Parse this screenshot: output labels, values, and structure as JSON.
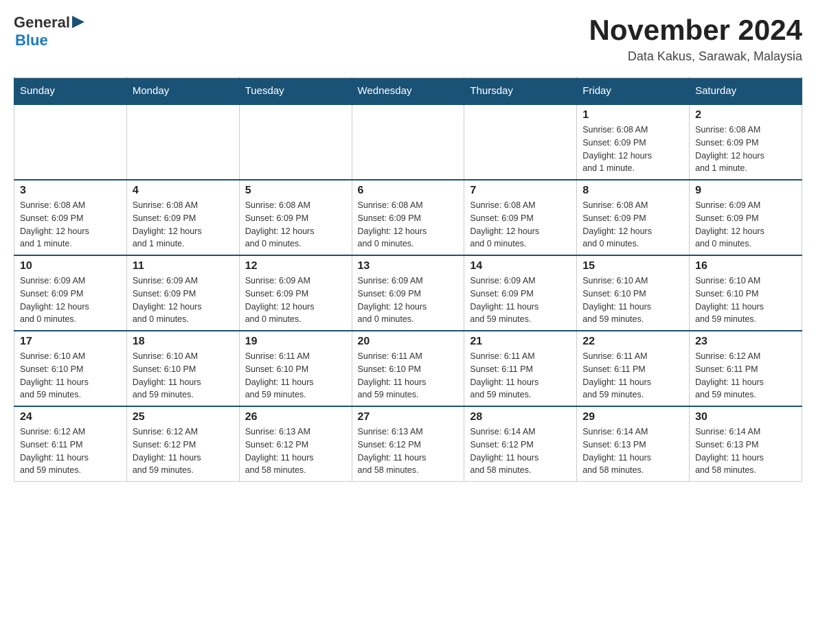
{
  "header": {
    "logo_text_general": "General",
    "logo_text_blue": "Blue",
    "month_title": "November 2024",
    "location": "Data Kakus, Sarawak, Malaysia"
  },
  "weekdays": [
    "Sunday",
    "Monday",
    "Tuesday",
    "Wednesday",
    "Thursday",
    "Friday",
    "Saturday"
  ],
  "weeks": [
    [
      {
        "day": "",
        "info": ""
      },
      {
        "day": "",
        "info": ""
      },
      {
        "day": "",
        "info": ""
      },
      {
        "day": "",
        "info": ""
      },
      {
        "day": "",
        "info": ""
      },
      {
        "day": "1",
        "info": "Sunrise: 6:08 AM\nSunset: 6:09 PM\nDaylight: 12 hours\nand 1 minute."
      },
      {
        "day": "2",
        "info": "Sunrise: 6:08 AM\nSunset: 6:09 PM\nDaylight: 12 hours\nand 1 minute."
      }
    ],
    [
      {
        "day": "3",
        "info": "Sunrise: 6:08 AM\nSunset: 6:09 PM\nDaylight: 12 hours\nand 1 minute."
      },
      {
        "day": "4",
        "info": "Sunrise: 6:08 AM\nSunset: 6:09 PM\nDaylight: 12 hours\nand 1 minute."
      },
      {
        "day": "5",
        "info": "Sunrise: 6:08 AM\nSunset: 6:09 PM\nDaylight: 12 hours\nand 0 minutes."
      },
      {
        "day": "6",
        "info": "Sunrise: 6:08 AM\nSunset: 6:09 PM\nDaylight: 12 hours\nand 0 minutes."
      },
      {
        "day": "7",
        "info": "Sunrise: 6:08 AM\nSunset: 6:09 PM\nDaylight: 12 hours\nand 0 minutes."
      },
      {
        "day": "8",
        "info": "Sunrise: 6:08 AM\nSunset: 6:09 PM\nDaylight: 12 hours\nand 0 minutes."
      },
      {
        "day": "9",
        "info": "Sunrise: 6:09 AM\nSunset: 6:09 PM\nDaylight: 12 hours\nand 0 minutes."
      }
    ],
    [
      {
        "day": "10",
        "info": "Sunrise: 6:09 AM\nSunset: 6:09 PM\nDaylight: 12 hours\nand 0 minutes."
      },
      {
        "day": "11",
        "info": "Sunrise: 6:09 AM\nSunset: 6:09 PM\nDaylight: 12 hours\nand 0 minutes."
      },
      {
        "day": "12",
        "info": "Sunrise: 6:09 AM\nSunset: 6:09 PM\nDaylight: 12 hours\nand 0 minutes."
      },
      {
        "day": "13",
        "info": "Sunrise: 6:09 AM\nSunset: 6:09 PM\nDaylight: 12 hours\nand 0 minutes."
      },
      {
        "day": "14",
        "info": "Sunrise: 6:09 AM\nSunset: 6:09 PM\nDaylight: 11 hours\nand 59 minutes."
      },
      {
        "day": "15",
        "info": "Sunrise: 6:10 AM\nSunset: 6:10 PM\nDaylight: 11 hours\nand 59 minutes."
      },
      {
        "day": "16",
        "info": "Sunrise: 6:10 AM\nSunset: 6:10 PM\nDaylight: 11 hours\nand 59 minutes."
      }
    ],
    [
      {
        "day": "17",
        "info": "Sunrise: 6:10 AM\nSunset: 6:10 PM\nDaylight: 11 hours\nand 59 minutes."
      },
      {
        "day": "18",
        "info": "Sunrise: 6:10 AM\nSunset: 6:10 PM\nDaylight: 11 hours\nand 59 minutes."
      },
      {
        "day": "19",
        "info": "Sunrise: 6:11 AM\nSunset: 6:10 PM\nDaylight: 11 hours\nand 59 minutes."
      },
      {
        "day": "20",
        "info": "Sunrise: 6:11 AM\nSunset: 6:10 PM\nDaylight: 11 hours\nand 59 minutes."
      },
      {
        "day": "21",
        "info": "Sunrise: 6:11 AM\nSunset: 6:11 PM\nDaylight: 11 hours\nand 59 minutes."
      },
      {
        "day": "22",
        "info": "Sunrise: 6:11 AM\nSunset: 6:11 PM\nDaylight: 11 hours\nand 59 minutes."
      },
      {
        "day": "23",
        "info": "Sunrise: 6:12 AM\nSunset: 6:11 PM\nDaylight: 11 hours\nand 59 minutes."
      }
    ],
    [
      {
        "day": "24",
        "info": "Sunrise: 6:12 AM\nSunset: 6:11 PM\nDaylight: 11 hours\nand 59 minutes."
      },
      {
        "day": "25",
        "info": "Sunrise: 6:12 AM\nSunset: 6:12 PM\nDaylight: 11 hours\nand 59 minutes."
      },
      {
        "day": "26",
        "info": "Sunrise: 6:13 AM\nSunset: 6:12 PM\nDaylight: 11 hours\nand 58 minutes."
      },
      {
        "day": "27",
        "info": "Sunrise: 6:13 AM\nSunset: 6:12 PM\nDaylight: 11 hours\nand 58 minutes."
      },
      {
        "day": "28",
        "info": "Sunrise: 6:14 AM\nSunset: 6:12 PM\nDaylight: 11 hours\nand 58 minutes."
      },
      {
        "day": "29",
        "info": "Sunrise: 6:14 AM\nSunset: 6:13 PM\nDaylight: 11 hours\nand 58 minutes."
      },
      {
        "day": "30",
        "info": "Sunrise: 6:14 AM\nSunset: 6:13 PM\nDaylight: 11 hours\nand 58 minutes."
      }
    ]
  ]
}
